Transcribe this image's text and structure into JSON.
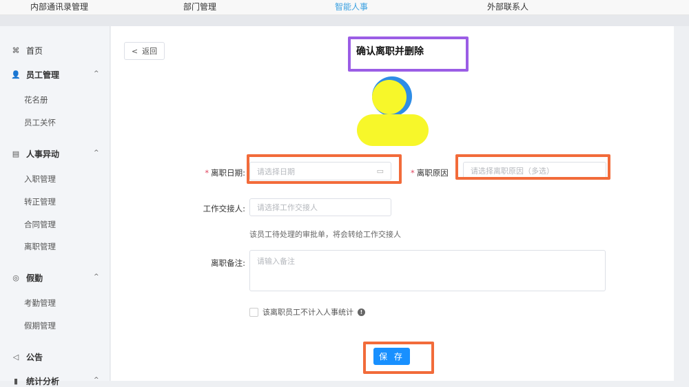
{
  "topnav": {
    "items": [
      "内部通讯录管理",
      "部门管理",
      "智能人事",
      "外部联系人"
    ],
    "active_color": "#3aa0e0"
  },
  "sidebar": {
    "items": [
      {
        "label": "首页",
        "icon": "home-icon"
      },
      {
        "label": "员工管理",
        "icon": "user-icon",
        "children": [
          "花名册",
          "员工关怀"
        ]
      },
      {
        "label": "人事异动",
        "icon": "document-icon",
        "children": [
          "入职管理",
          "转正管理",
          "合同管理",
          "离职管理"
        ]
      },
      {
        "label": "假勤",
        "icon": "location-icon",
        "children": [
          "考勤管理",
          "假期管理"
        ]
      },
      {
        "label": "公告",
        "icon": "speaker-icon"
      },
      {
        "label": "统计分析",
        "icon": "chart-icon"
      }
    ]
  },
  "main": {
    "back_label": "返回",
    "title": "确认离职并删除",
    "form": {
      "date_label": "离职日期",
      "date_placeholder": "请选择日期",
      "reason_label": "离职原因",
      "reason_placeholder": "请选择离职原因（多选）",
      "handover_label": "工作交接人",
      "handover_placeholder": "请选择工作交接人",
      "handover_hint": "该员工待处理的审批单，将会转给工作交接人",
      "remark_label": "离职备注",
      "remark_placeholder": "请输入备注",
      "exclude_label": "该离职员工不计入人事统计"
    },
    "save_label": "保 存"
  },
  "colors": {
    "highlight": "#f26b3a",
    "title_box": "#9b5de5",
    "primary": "#1890ff",
    "avatar_yellow": "#f7f72a",
    "avatar_blue": "#2e8de6"
  }
}
